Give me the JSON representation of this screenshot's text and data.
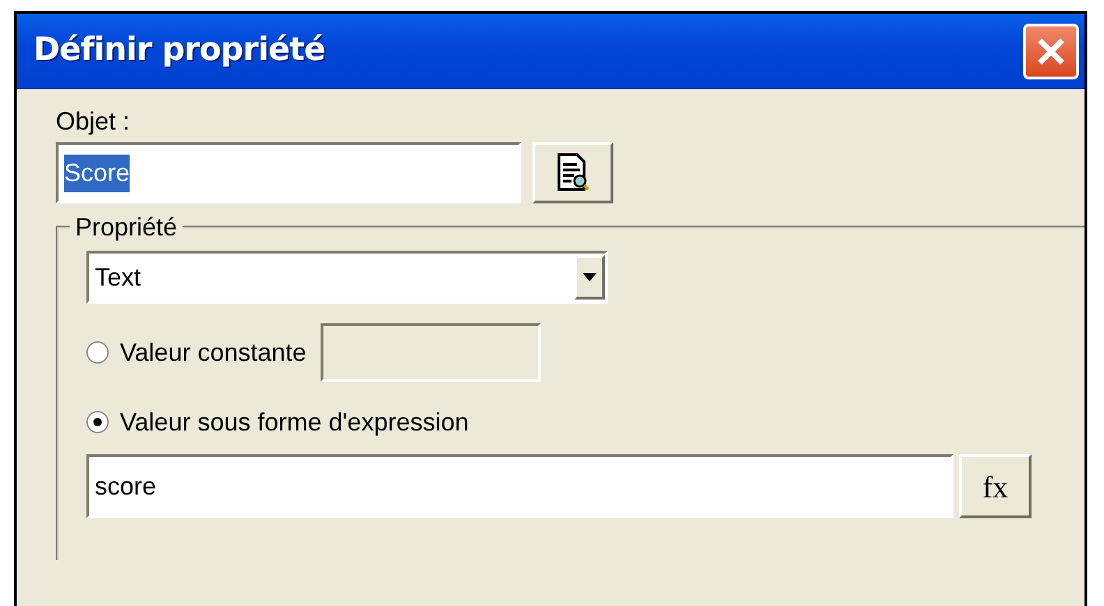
{
  "window": {
    "title": "Définir propriété"
  },
  "object": {
    "label": "Objet :",
    "value": "Score",
    "selected": true
  },
  "property": {
    "legend": "Propriété",
    "dropdown": "Text",
    "options": [
      {
        "kind": "constant",
        "label": "Valeur constante",
        "selected": false
      },
      {
        "kind": "expression",
        "label": "Valeur sous forme d'expression",
        "selected": true
      }
    ],
    "expression": "score",
    "fx_button": "fx"
  }
}
